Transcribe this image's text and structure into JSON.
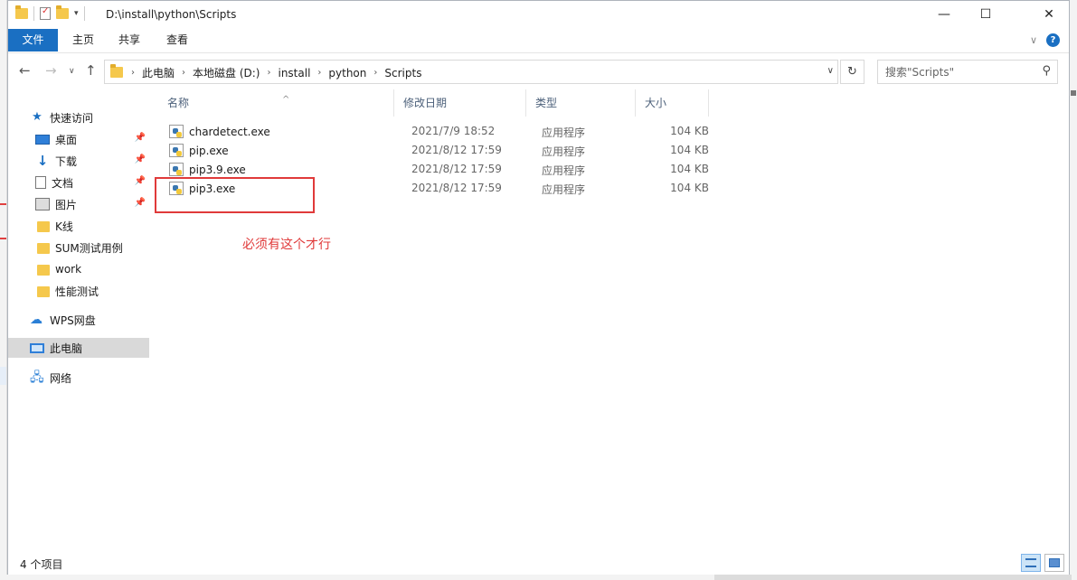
{
  "title_bar": {
    "path_title": "D:\\install\\python\\Scripts",
    "minimize_symbol": "—",
    "maximize_symbol": "☐",
    "close_symbol": "✕"
  },
  "ribbon": {
    "tabs": [
      {
        "label": "文件",
        "active": true
      },
      {
        "label": "主页"
      },
      {
        "label": "共享"
      },
      {
        "label": "查看"
      }
    ]
  },
  "address_bar": {
    "breadcrumbs": [
      "此电脑",
      "本地磁盘 (D:)",
      "install",
      "python",
      "Scripts"
    ],
    "search_placeholder": "搜索\"Scripts\""
  },
  "nav_pane": {
    "items": [
      {
        "label": "快速访问",
        "icon": "star-icon"
      },
      {
        "label": "桌面",
        "icon": "desktop-icon",
        "pinned": true
      },
      {
        "label": "下载",
        "icon": "download-icon",
        "pinned": true
      },
      {
        "label": "文档",
        "icon": "document-icon",
        "pinned": true
      },
      {
        "label": "图片",
        "icon": "picture-icon",
        "pinned": true
      },
      {
        "label": "K线",
        "icon": "folder-icon"
      },
      {
        "label": "SUM测试用例",
        "icon": "folder-icon"
      },
      {
        "label": "work",
        "icon": "folder-icon"
      },
      {
        "label": "性能测试",
        "icon": "folder-icon"
      },
      {
        "label": "WPS网盘",
        "icon": "cloud-icon"
      },
      {
        "label": "此电脑",
        "icon": "computer-icon",
        "selected": true
      },
      {
        "label": "网络",
        "icon": "network-icon"
      }
    ]
  },
  "file_list": {
    "columns": [
      "名称",
      "修改日期",
      "类型",
      "大小"
    ],
    "rows": [
      {
        "name": "chardetect.exe",
        "date": "2021/7/9 18:52",
        "type": "应用程序",
        "size": "104 KB"
      },
      {
        "name": "pip.exe",
        "date": "2021/8/12 17:59",
        "type": "应用程序",
        "size": "104 KB"
      },
      {
        "name": "pip3.9.exe",
        "date": "2021/8/12 17:59",
        "type": "应用程序",
        "size": "104 KB"
      },
      {
        "name": "pip3.exe",
        "date": "2021/8/12 17:59",
        "type": "应用程序",
        "size": "104 KB"
      }
    ]
  },
  "annotation": {
    "text": "必须有这个才行",
    "color": "#e03a3a"
  },
  "status_bar": {
    "item_count": "4 个项目"
  },
  "colors": {
    "accent": "#1a6fc2",
    "selection": "#d9d9d9"
  }
}
